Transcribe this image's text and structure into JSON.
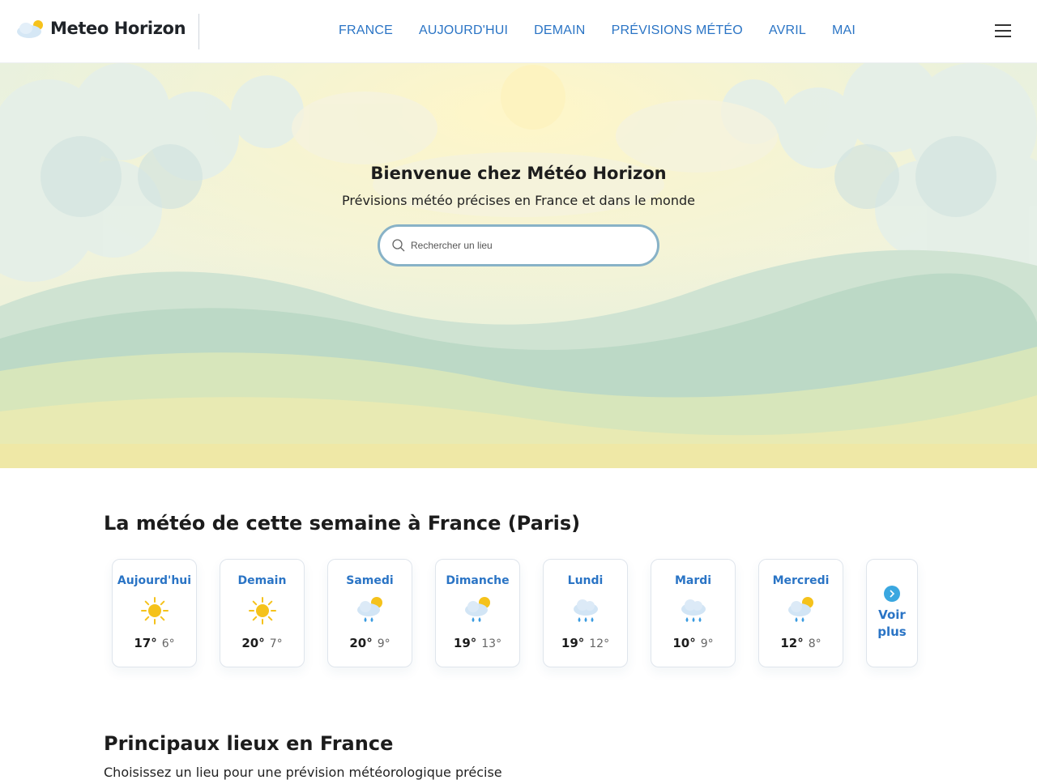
{
  "header": {
    "brand": "Meteo Horizon",
    "nav": [
      "FRANCE",
      "AUJOURD'HUI",
      "DEMAIN",
      "PRÉVISIONS MÉTÉO",
      "AVRIL",
      "MAI"
    ],
    "menu_icon": "hamburger-menu-icon"
  },
  "hero": {
    "title": "Bienvenue chez Météo Horizon",
    "subtitle": "Prévisions météo précises en France et dans le monde",
    "search_placeholder": "Rechercher un lieu"
  },
  "week": {
    "title": "La météo de cette semaine à France (Paris)",
    "days": [
      {
        "name": "Aujourd'hui",
        "icon": "sun-icon",
        "max": "17°",
        "min": "6°"
      },
      {
        "name": "Demain",
        "icon": "sun-icon",
        "max": "20°",
        "min": "7°"
      },
      {
        "name": "Samedi",
        "icon": "sun-cloud-rain-icon",
        "max": "20°",
        "min": "9°"
      },
      {
        "name": "Dimanche",
        "icon": "sun-cloud-rain-icon",
        "max": "19°",
        "min": "13°"
      },
      {
        "name": "Lundi",
        "icon": "cloud-rain-icon",
        "max": "19°",
        "min": "12°"
      },
      {
        "name": "Mardi",
        "icon": "cloud-rain-icon",
        "max": "10°",
        "min": "9°"
      },
      {
        "name": "Mercredi",
        "icon": "sun-cloud-rain-icon",
        "max": "12°",
        "min": "8°"
      }
    ],
    "more_label": "Voir plus",
    "more_icon": "chevron-right-icon"
  },
  "places": {
    "title": "Principaux lieux en France",
    "subtitle": "Choisissez un lieu pour une prévision météorologique précise"
  },
  "colors": {
    "accent": "#2a74c5",
    "search_border": "#88b2c7",
    "sun": "#f5c21b",
    "rain": "#3a9be0"
  }
}
